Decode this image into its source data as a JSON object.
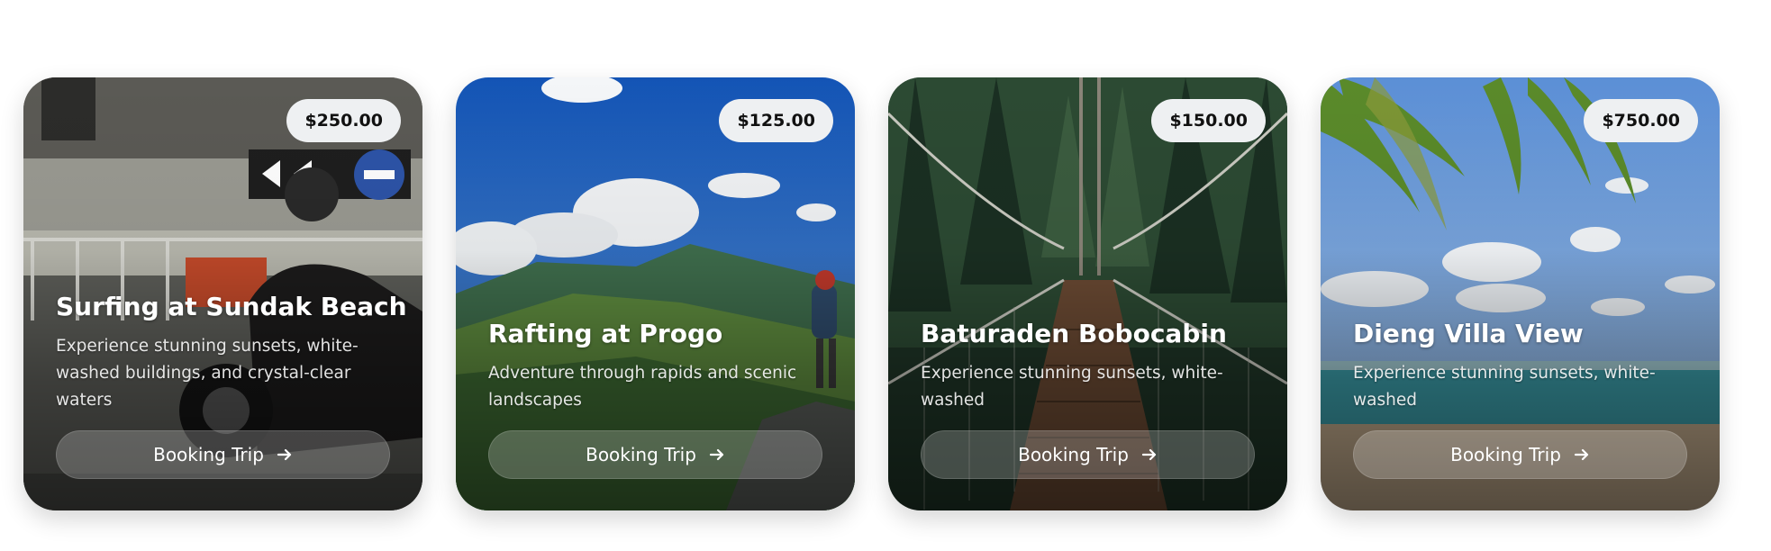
{
  "cards": [
    {
      "price": "$250.00",
      "title": "Surfing at Sundak Beach",
      "description": "Experience stunning sunsets, white-washed buildings, and crystal-clear waters",
      "button_label": "Booking Trip",
      "button_icon": "arrow-right-icon"
    },
    {
      "price": "$125.00",
      "title": "Rafting at Progo",
      "description": "Adventure through rapids and scenic landscapes",
      "button_label": "Booking Trip",
      "button_icon": "arrow-right-icon"
    },
    {
      "price": "$150.00",
      "title": "Baturaden Bobocabin",
      "description": "Experience stunning sunsets, white-washed",
      "button_label": "Booking Trip",
      "button_icon": "arrow-right-icon"
    },
    {
      "price": "$750.00",
      "title": "Dieng Villa View",
      "description": "Experience stunning sunsets, white-washed",
      "button_label": "Booking Trip",
      "button_icon": "arrow-right-icon"
    }
  ]
}
